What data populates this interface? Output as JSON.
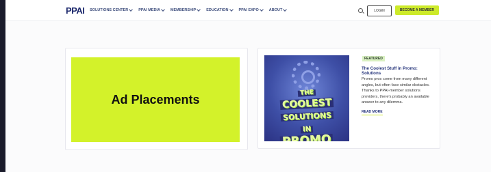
{
  "header": {
    "logo": "PPAI",
    "nav": [
      {
        "label": "SOLUTIONS CENTER"
      },
      {
        "label": "PPAI MEDIA"
      },
      {
        "label": "MEMBERSHIP"
      },
      {
        "label": "EDUCATION"
      },
      {
        "label": "PPAI EXPO"
      },
      {
        "label": "ABOUT"
      }
    ],
    "login_label": "LOGIN",
    "become_member_label": "BECOME A MEMBER"
  },
  "ad": {
    "label": "Ad Placements",
    "color": "#d3f22a"
  },
  "article": {
    "badge": "FEATURED",
    "title": "The Coolest Stuff in Promo: Solutions",
    "body": "Promo pros come from many different angles, but often face similar obstacles. Thanks to PPAI-member solutions providers, there's probably an available answer to any dilemma.",
    "read_more": "READ MORE",
    "image_words": [
      "THE",
      "COOLEST",
      "SOLUTIONS",
      "IN",
      "PROMO"
    ]
  },
  "colors": {
    "accent": "#cdea2a",
    "navy": "#24337a",
    "outer_bg": "#1a1b2b"
  }
}
